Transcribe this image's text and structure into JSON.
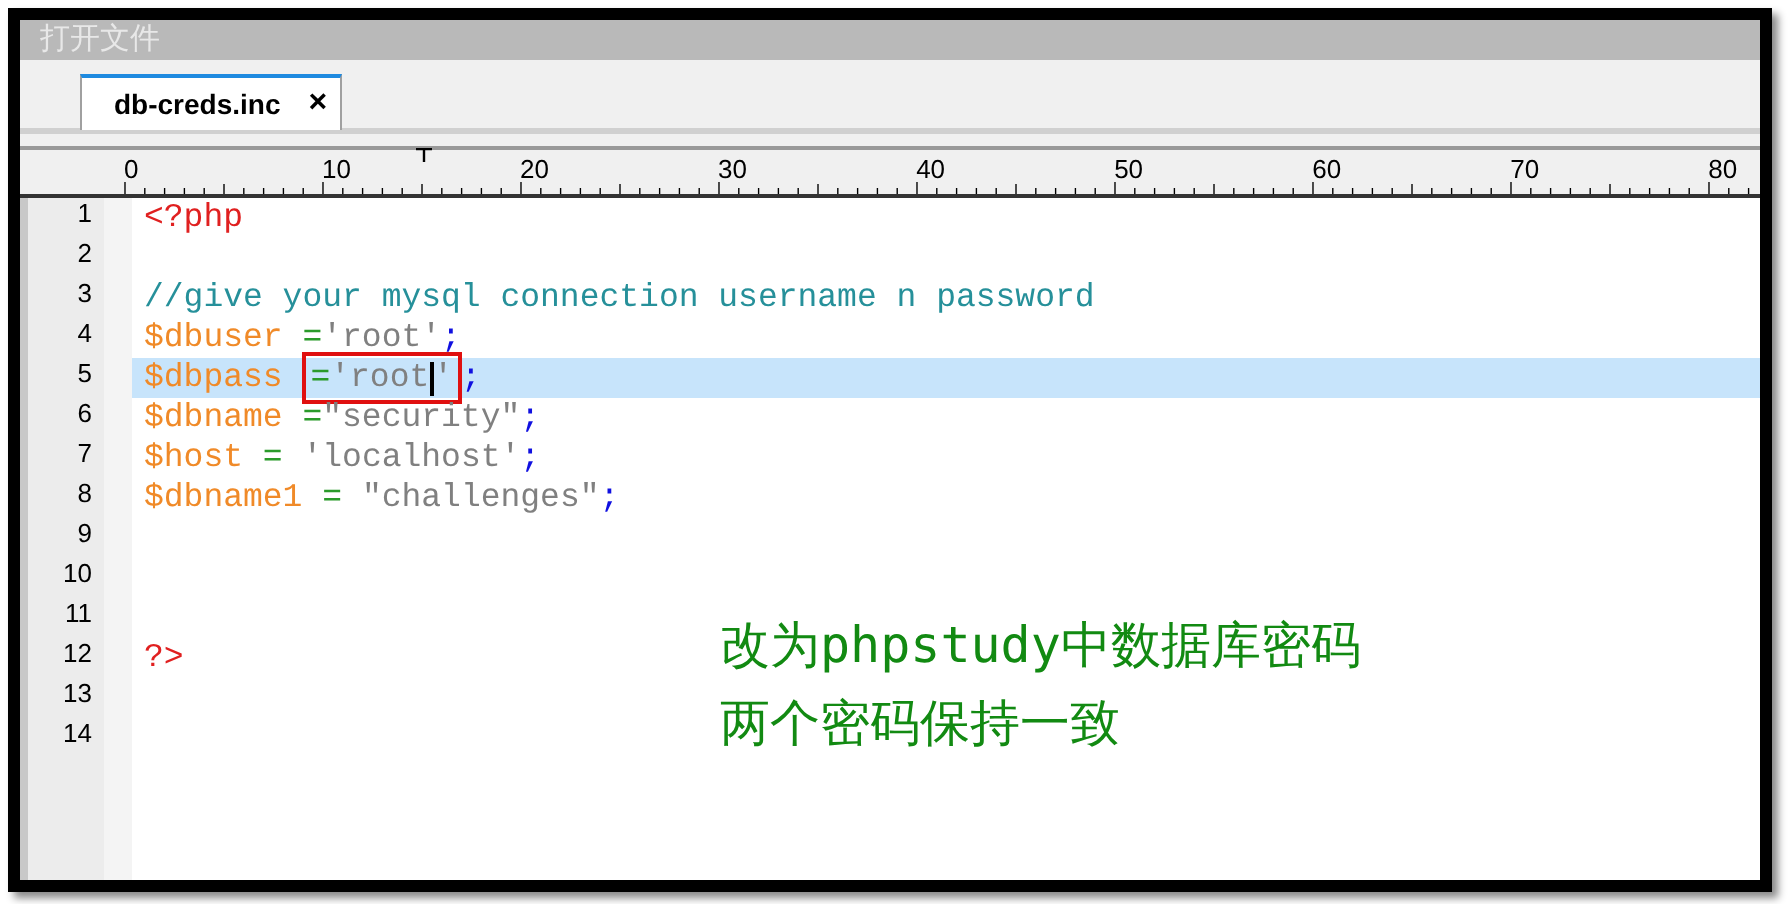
{
  "window": {
    "title": "打开文件"
  },
  "tabs": [
    {
      "label": "db-creds.inc",
      "close": "×",
      "selected": true
    }
  ],
  "ruler": {
    "labels": [
      "0",
      "10",
      "20",
      "30",
      "40",
      "50",
      "60",
      "70",
      "80"
    ]
  },
  "editor": {
    "lines": [
      {
        "number": "1",
        "highlighted": false,
        "tokens": [
          {
            "kind": "tag",
            "text": "<?php"
          }
        ]
      },
      {
        "number": "2",
        "highlighted": false
      },
      {
        "number": "3",
        "highlighted": false,
        "tokens": [
          {
            "kind": "comment",
            "text": "//give your mysql connection username n password"
          }
        ]
      },
      {
        "number": "4",
        "highlighted": false,
        "tokens": [
          {
            "kind": "variable",
            "text": "$dbuser"
          },
          {
            "kind": "operator",
            "text": " ="
          },
          {
            "kind": "string",
            "text": "'root'"
          },
          {
            "kind": "punct",
            "text": ";"
          }
        ]
      },
      {
        "number": "5",
        "highlighted": true,
        "tokens": [
          {
            "kind": "variable",
            "text": "$dbpass "
          },
          {
            "kind": "operator",
            "text": "=",
            "boxed": true
          },
          {
            "kind": "string",
            "text": "'root",
            "boxed": true,
            "caret": true
          },
          {
            "kind": "string",
            "text": "'",
            "boxed": true
          },
          {
            "kind": "punct",
            "text": ";"
          }
        ]
      },
      {
        "number": "6",
        "highlighted": false,
        "tokens": [
          {
            "kind": "variable",
            "text": "$dbname"
          },
          {
            "kind": "operator",
            "text": " ="
          },
          {
            "kind": "string",
            "text": "\"security\""
          },
          {
            "kind": "punct",
            "text": ";"
          }
        ]
      },
      {
        "number": "7",
        "highlighted": false,
        "tokens": [
          {
            "kind": "variable",
            "text": "$host"
          },
          {
            "kind": "operator",
            "text": " = "
          },
          {
            "kind": "string",
            "text": "'localhost'"
          },
          {
            "kind": "punct",
            "text": ";"
          }
        ]
      },
      {
        "number": "8",
        "highlighted": false,
        "tokens": [
          {
            "kind": "variable",
            "text": "$dbname1"
          },
          {
            "kind": "operator",
            "text": " = "
          },
          {
            "kind": "string",
            "text": "\"challenges\""
          },
          {
            "kind": "punct",
            "text": ";"
          }
        ]
      },
      {
        "number": "9",
        "highlighted": false
      },
      {
        "number": "10",
        "highlighted": false
      },
      {
        "number": "11",
        "highlighted": false
      },
      {
        "number": "12",
        "highlighted": false,
        "tokens": [
          {
            "kind": "tag",
            "text": "?>"
          }
        ]
      },
      {
        "number": "13",
        "highlighted": false
      },
      {
        "number": "14",
        "highlighted": false
      }
    ]
  },
  "annotation": {
    "lines": [
      "改为phpstudy中数据库密码",
      "两个密码保持一致"
    ]
  }
}
